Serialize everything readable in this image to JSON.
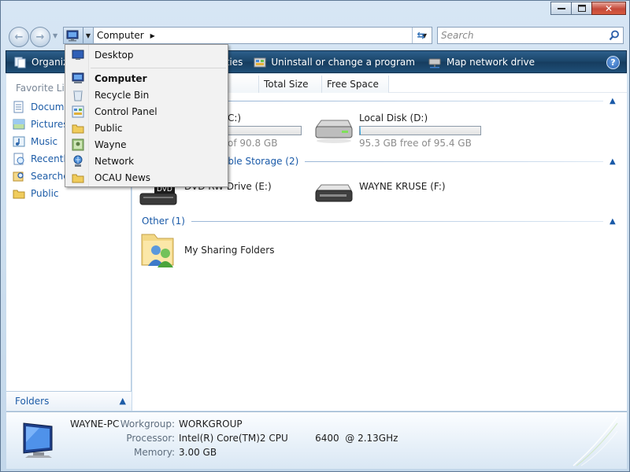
{
  "address": {
    "location": "Computer"
  },
  "search": {
    "placeholder": "Search"
  },
  "command_bar": {
    "organize": "Organiz",
    "properties": "erties",
    "uninstall": "Uninstall or change a program",
    "map_drive": "Map network drive"
  },
  "nav_pane": {
    "heading": "Favorite Lin",
    "items": [
      "Docume",
      "Pictures",
      "Music",
      "Recently",
      "Searche",
      "Public"
    ],
    "folders_label": "Folders"
  },
  "columns": [
    "Total Size",
    "Free Space"
  ],
  "groups": {
    "removable": "able Storage (2)",
    "other": "Other (1)"
  },
  "drives": {
    "c": {
      "name": "C:)",
      "free": "of 90.8 GB",
      "used_fraction": 0.05
    },
    "d": {
      "name": "Local Disk (D:)",
      "free": "95.3 GB free of 95.4 GB",
      "used_fraction": 0.001
    },
    "e": {
      "name": "DVD RW Drive (E:)",
      "badge": "DVD"
    },
    "f": {
      "name": "WAYNE KRUSE (F:)"
    },
    "sharing": {
      "name": "My Sharing Folders"
    }
  },
  "details": {
    "computer_name": "WAYNE-PC",
    "workgroup_label": "Workgroup:",
    "workgroup": "WORKGROUP",
    "processor_label": "Processor:",
    "processor": "Intel(R) Core(TM)2 CPU         6400  @ 2.13GHz",
    "memory_label": "Memory:",
    "memory": "3.00 GB"
  },
  "menu": {
    "desktop": "Desktop",
    "items": [
      "Computer",
      "Recycle Bin",
      "Control Panel",
      "Public",
      "Wayne",
      "Network",
      "OCAU News"
    ]
  },
  "colors": {
    "command_bar": "#1a4468",
    "link_blue": "#1d5ca7",
    "drive_bar": "#279fd8"
  }
}
